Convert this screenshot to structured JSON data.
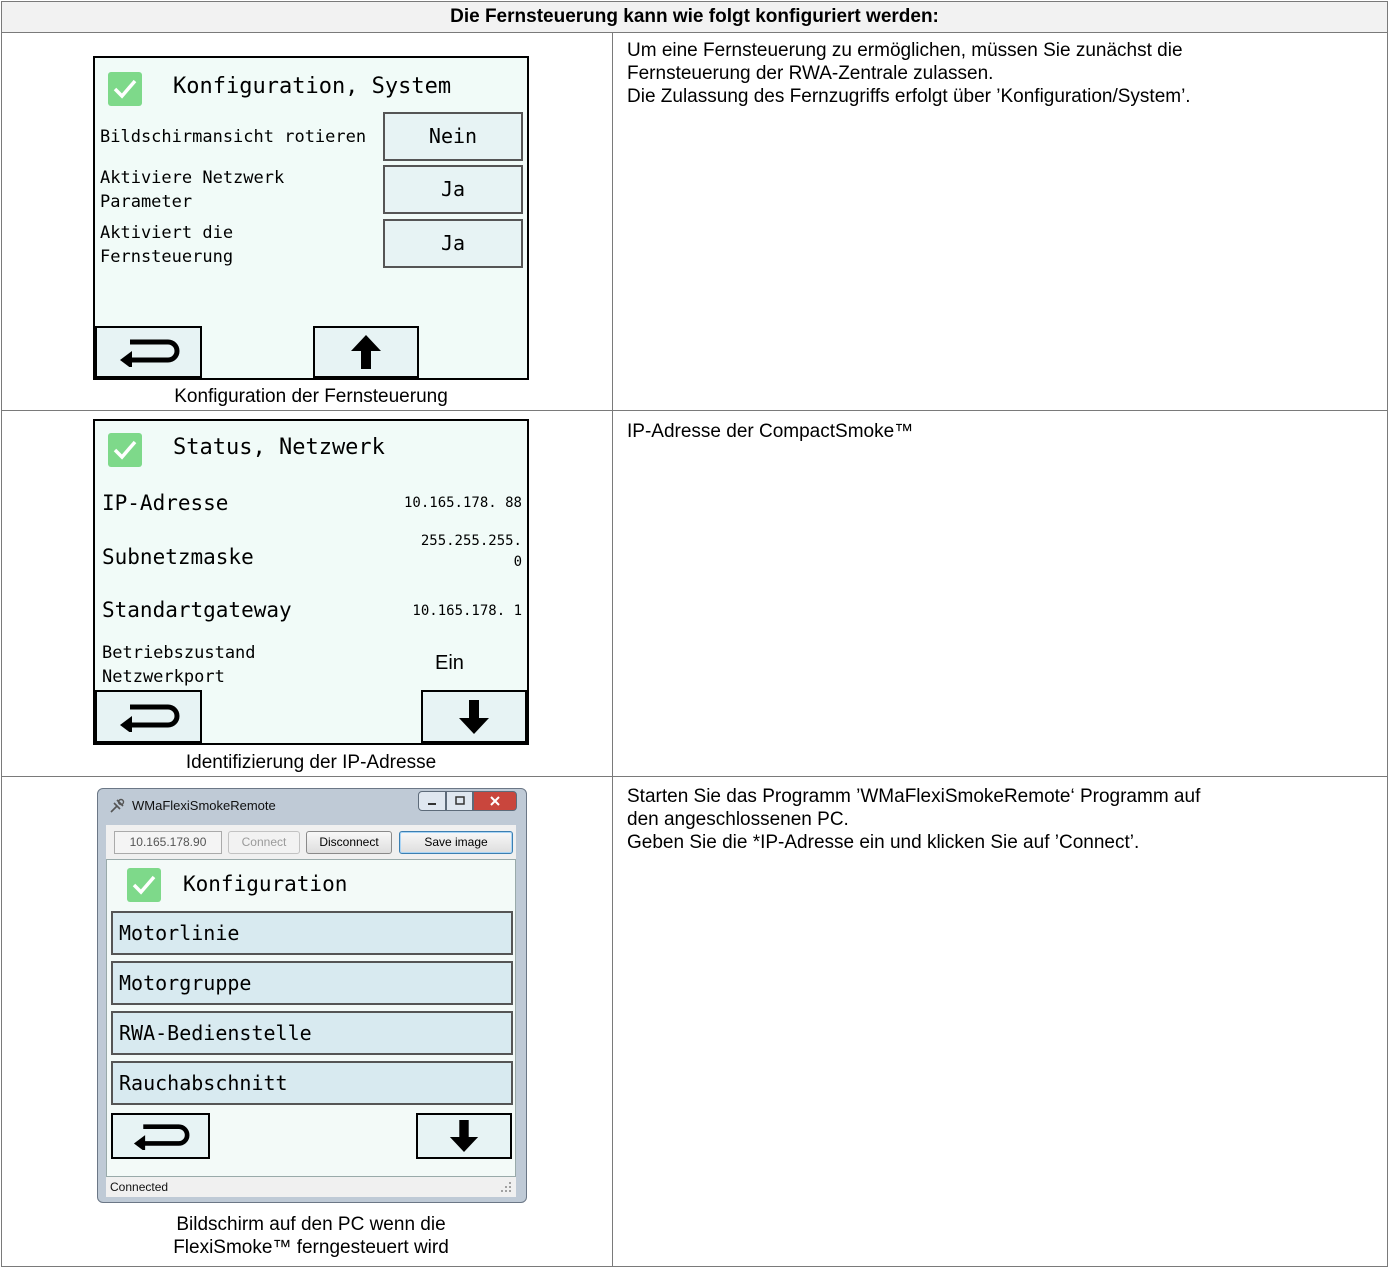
{
  "header": {
    "title": "Die Fernsteuerung kann wie folgt konfiguriert werden:"
  },
  "row1": {
    "screen": {
      "title": "Konfiguration, System",
      "rows": [
        {
          "label_lines": [
            "Bildschirmansicht rotieren"
          ],
          "value": "Nein"
        },
        {
          "label_lines": [
            "Aktiviere Netzwerk",
            "Parameter"
          ],
          "value": "Ja"
        },
        {
          "label_lines": [
            "Aktiviert die",
            "Fernsteuerung"
          ],
          "value": "Ja"
        }
      ]
    },
    "caption": "Konfiguration der Fernsteuerung",
    "description": [
      "Um eine Fernsteuerung zu ermöglichen, müssen Sie zunächst die",
      "Fernsteuerung der RWA-Zentrale zulassen.",
      "Die Zulassung des Fernzugriffs erfolgt über ’Konfiguration/System’."
    ]
  },
  "row2": {
    "screen": {
      "title": "Status, Netzwerk",
      "ip_label": "IP-Adresse",
      "ip_value": "10.165.178. 88",
      "subnet_label": "Subnetzmaske",
      "subnet_value_lines": [
        "255.255.255.",
        "0"
      ],
      "gateway_label": "Standartgateway",
      "gateway_value": "10.165.178. 1",
      "port_label_lines": [
        "Betriebszustand",
        "Netzwerkport"
      ],
      "port_value": "Ein"
    },
    "caption": "Identifizierung der IP-Adresse",
    "description": [
      "IP-Adresse der CompactSmoke™"
    ]
  },
  "row3": {
    "window": {
      "title": "WMaFlexiSmokeRemote",
      "ip_input": "10.165.178.90",
      "connect": "Connect",
      "disconnect": "Disconnect",
      "save_image": "Save image",
      "screen_title": "Konfiguration",
      "menu": [
        "Motorlinie",
        "Motorgruppe",
        "RWA-Bedienstelle",
        "Rauchabschnitt"
      ],
      "status": "Connected"
    },
    "caption_lines": [
      "Bildschirm auf den PC wenn die",
      "FlexiSmoke™ ferngesteuert wird"
    ],
    "description": [
      "Starten Sie das Programm ’WMaFlexiSmokeRemote‘ Programm auf",
      "den angeschlossenen PC.",
      "Geben Sie die *IP-Adresse ein und klicken Sie auf ’Connect’."
    ]
  },
  "icons": [
    "check-icon",
    "return-arrow-icon",
    "arrow-up-icon",
    "arrow-down-icon",
    "app-icon",
    "minimize-icon",
    "maximize-icon",
    "close-icon",
    "resize-grip-icon"
  ],
  "colors": {
    "check_green": "#7ed98a",
    "screen_bg": "#f1fbf8",
    "button_bg": "#e7f3f4",
    "header_bg": "#f2f2f2"
  }
}
